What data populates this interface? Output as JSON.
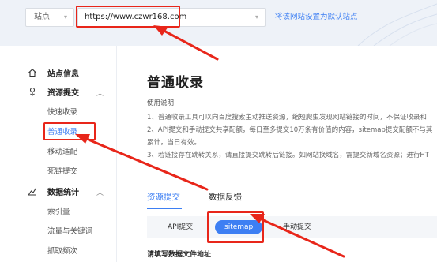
{
  "topbar": {
    "site_label": "站点",
    "site_url": "https://www.czwr168.com",
    "set_default_link": "将该网站设置为默认站点",
    "chevron": "▾"
  },
  "sidebar": {
    "groups": [
      {
        "label": "站点信息",
        "icon": "home-icon"
      },
      {
        "label": "资源提交",
        "icon": "submit-icon",
        "chevron": "︿"
      },
      {
        "label": "数据统计",
        "icon": "stats-icon",
        "chevron": "︿"
      }
    ],
    "items": [
      "快速收录",
      "普通收录",
      "移动适配",
      "死链提交",
      "索引量",
      "流量与关键词",
      "抓取频次"
    ],
    "active_item": "普通收录"
  },
  "main": {
    "title": "普通收录",
    "usage_title": "使用说明",
    "usage_lines": [
      "1、普通收录工具可以向百度搜索主动推送资源，缩短爬虫发现网站链接的时间，不保证收录和",
      "2、API提交和手动提交共享配额，每日至多提交10万条有价值的内容，sitemap提交配额不与其",
      "累计，当日有效。",
      "3、若链接存在跳转关系，请直接提交跳转后链接。如网站换域名，需提交新域名资源；进行HT"
    ],
    "tabs": [
      "资源提交",
      "数据反馈"
    ],
    "subtabs": [
      "API提交",
      "sitemap",
      "手动提交"
    ],
    "field_label": "请填写数据文件地址"
  },
  "colors": {
    "accent": "#3d7ff3",
    "annotation": "#e8261a",
    "topbar_bg": "#eef2f8"
  }
}
